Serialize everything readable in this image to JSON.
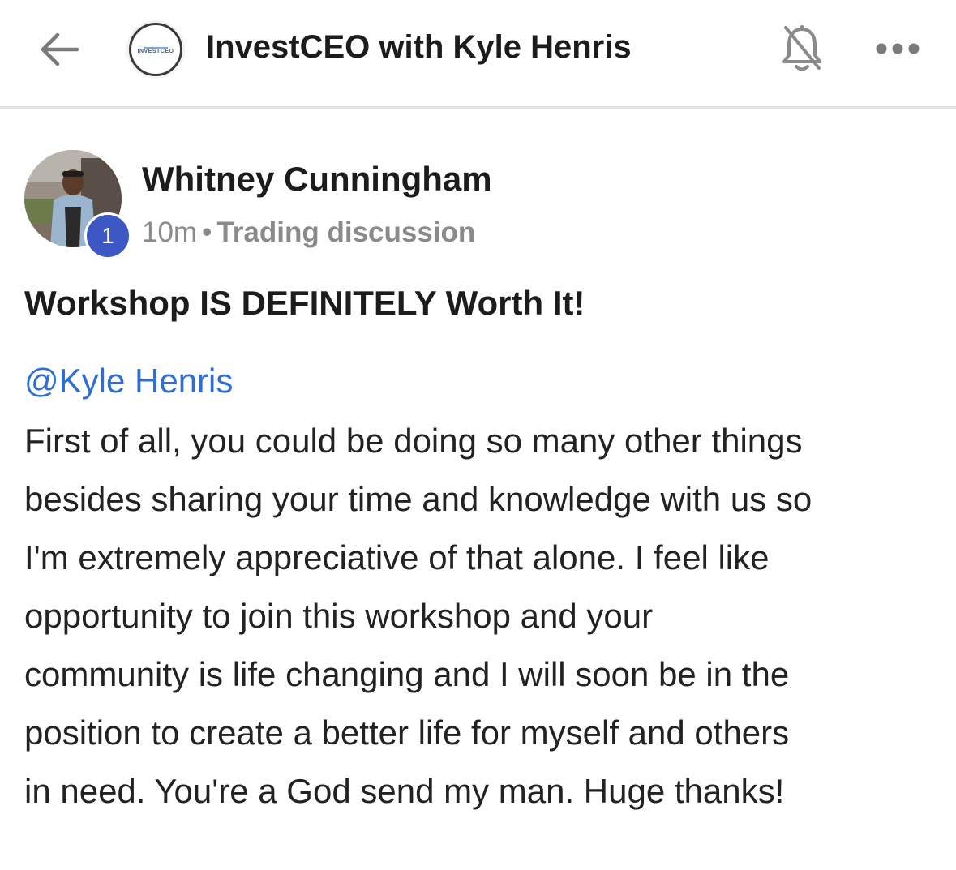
{
  "header": {
    "back_icon": "arrow-left-icon",
    "group_logo_text": "INVESTCEO",
    "group_title": "InvestCEO with Kyle Henris",
    "bell_icon": "bell-off-icon",
    "more_icon": "more-horizontal-icon"
  },
  "post": {
    "author_name": "Whitney Cunningham",
    "level": "1",
    "time": "10m",
    "separator": "•",
    "category": "Trading discussion",
    "title": "Workshop IS DEFINITELY Worth It!",
    "mention": "@Kyle Henris",
    "body_lines": [
      "First of all, you could be doing so many other things",
      "besides sharing your time and knowledge with us so",
      "I'm extremely appreciative of that alone. I feel like",
      "opportunity to join this workshop and your",
      "community is life changing and I will soon be in the",
      "position to create a better life for myself and others",
      "in need. You're a God send my man. Huge thanks!"
    ]
  },
  "colors": {
    "mention": "#2f6fd3",
    "level_badge": "#3d58c4",
    "meta": "#8a8a8a",
    "divider": "#e3e3e3"
  }
}
